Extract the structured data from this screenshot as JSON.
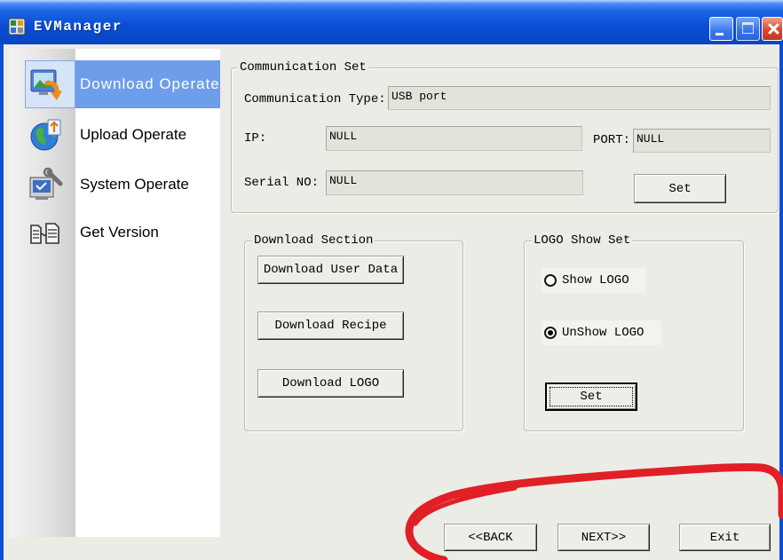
{
  "window": {
    "title": "EVManager",
    "icon": "app-icon",
    "controls": {
      "minimize_icon": "minimize-icon",
      "maximize_icon": "maximize-icon",
      "close_icon": "close-icon"
    }
  },
  "sidebar": {
    "items": [
      {
        "label": "Download Operate",
        "icon": "download-operate-icon",
        "selected": true
      },
      {
        "label": "Upload Operate",
        "icon": "upload-operate-icon",
        "selected": false
      },
      {
        "label": "System Operate",
        "icon": "system-operate-icon",
        "selected": false
      },
      {
        "label": "Get Version",
        "icon": "get-version-icon",
        "selected": false
      }
    ]
  },
  "communication_set": {
    "title": "Communication Set",
    "type_label": "Communication Type:",
    "type_value": "USB port",
    "ip_label": "IP:",
    "ip_value": "NULL",
    "port_label": "PORT:",
    "port_value": "NULL",
    "serial_label": "Serial NO:",
    "serial_value": "NULL",
    "set_button": "Set"
  },
  "download_section": {
    "title": "Download Section",
    "buttons": [
      "Download User Data",
      "Download Recipe",
      "Download LOGO"
    ]
  },
  "logo_show_set": {
    "title": "LOGO Show Set",
    "options": [
      {
        "label": "Show LOGO",
        "checked": false
      },
      {
        "label": "UnShow LOGO",
        "checked": true
      }
    ],
    "set_button": "Set"
  },
  "navigation": {
    "back_button": "<<BACK",
    "next_button": "NEXT>>",
    "exit_button": "Exit"
  },
  "colors": {
    "title_bar": "#0A4ED6",
    "selection": "#6E9DEA",
    "client_background": "#ECECE6",
    "close_button": "#D9482C",
    "annotation": "#E11F27"
  }
}
